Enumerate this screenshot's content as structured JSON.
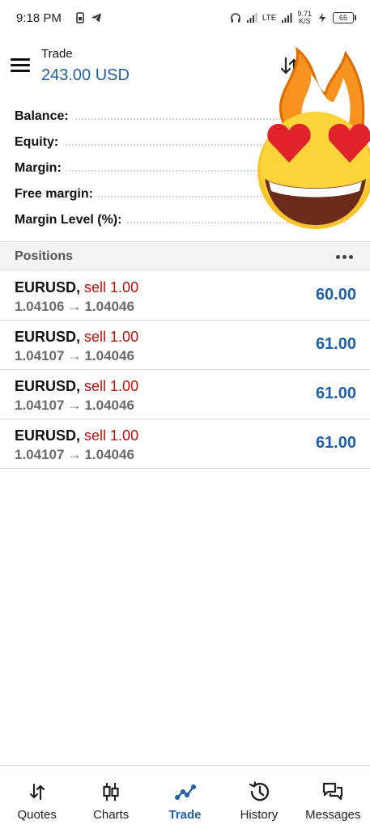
{
  "status_bar": {
    "time": "9:18 PM",
    "network": "LTE",
    "speed_value": "9.71",
    "speed_unit": "K/S",
    "battery": "65"
  },
  "header": {
    "title": "Trade",
    "amount": "243.00 USD"
  },
  "summary": [
    {
      "label": "Balance:"
    },
    {
      "label": "Equity:"
    },
    {
      "label": "Margin:"
    },
    {
      "label": "Free margin:"
    },
    {
      "label": "Margin Level (%):"
    }
  ],
  "positions": {
    "header": "Positions",
    "items": [
      {
        "symbol": "EURUSD,",
        "side": "sell 1.00",
        "open_price": "1.04106",
        "current_price": "1.04046",
        "profit": "60.00"
      },
      {
        "symbol": "EURUSD,",
        "side": "sell 1.00",
        "open_price": "1.04107",
        "current_price": "1.04046",
        "profit": "61.00"
      },
      {
        "symbol": "EURUSD,",
        "side": "sell 1.00",
        "open_price": "1.04107",
        "current_price": "1.04046",
        "profit": "61.00"
      },
      {
        "symbol": "EURUSD,",
        "side": "sell 1.00",
        "open_price": "1.04107",
        "current_price": "1.04046",
        "profit": "61.00"
      }
    ]
  },
  "nav": {
    "quotes": "Quotes",
    "charts": "Charts",
    "trade": "Trade",
    "history": "History",
    "messages": "Messages"
  },
  "colors": {
    "accent": "#1f5fa6",
    "sell": "#b5120e",
    "muted": "#6b6b6b"
  },
  "icons": [
    "menu-icon",
    "sort-icon",
    "more-icon",
    "quotes-icon",
    "charts-icon",
    "trade-icon",
    "history-icon",
    "messages-icon"
  ]
}
